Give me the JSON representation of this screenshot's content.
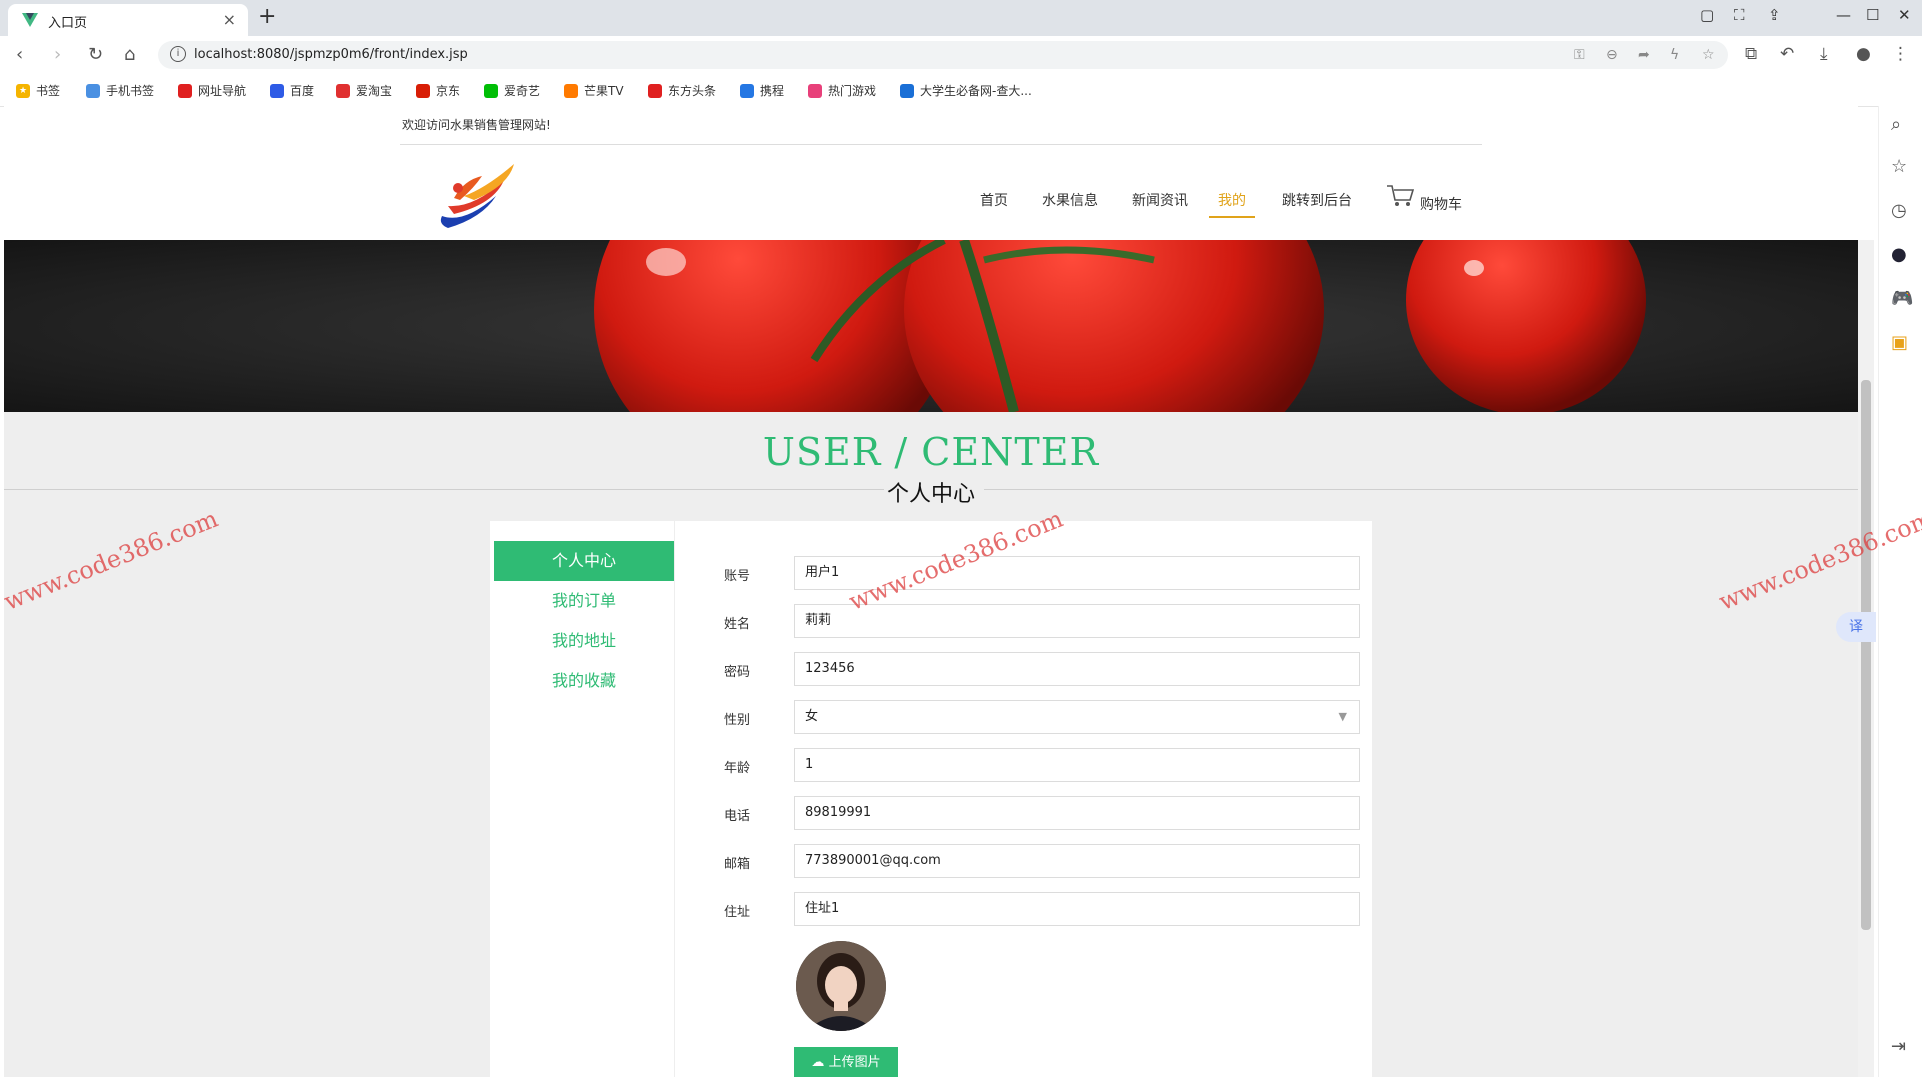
{
  "browser": {
    "tab_title": "入口页",
    "url": "localhost:8080/jspmzp0m6/front/index.jsp",
    "bookmarks": [
      {
        "label": "书签",
        "color": "#f5b400"
      },
      {
        "label": "手机书签",
        "color": "#4a90e2"
      },
      {
        "label": "网址导航",
        "color": "#e02020"
      },
      {
        "label": "百度",
        "color": "#2e5be6"
      },
      {
        "label": "爱淘宝",
        "color": "#e03030"
      },
      {
        "label": "京东",
        "color": "#d81e06"
      },
      {
        "label": "爱奇艺",
        "color": "#00be06"
      },
      {
        "label": "芒果TV",
        "color": "#ff7a00"
      },
      {
        "label": "东方头条",
        "color": "#e02020"
      },
      {
        "label": "携程",
        "color": "#2577e3"
      },
      {
        "label": "热门游戏",
        "color": "#e8407a"
      },
      {
        "label": "大学生必备网-查大...",
        "color": "#1a6fd6"
      }
    ],
    "translate_label": "译"
  },
  "header": {
    "welcome": "欢迎访问水果销售管理网站!",
    "nav": [
      "首页",
      "水果信息",
      "新闻资讯",
      "我的",
      "跳转到后台"
    ],
    "active_nav": "我的",
    "cart_label": "购物车"
  },
  "section": {
    "title_en": "USER / CENTER",
    "title_cn": "个人中心"
  },
  "sidebar": {
    "items": [
      "个人中心",
      "我的订单",
      "我的地址",
      "我的收藏"
    ],
    "active": "个人中心"
  },
  "form": {
    "fields": [
      {
        "label": "账号",
        "value": "用户1",
        "type": "text"
      },
      {
        "label": "姓名",
        "value": "莉莉",
        "type": "text"
      },
      {
        "label": "密码",
        "value": "123456",
        "type": "text"
      },
      {
        "label": "性别",
        "value": "女",
        "type": "select"
      },
      {
        "label": "年龄",
        "value": "1",
        "type": "text"
      },
      {
        "label": "电话",
        "value": "89819991",
        "type": "text"
      },
      {
        "label": "邮箱",
        "value": "773890001@qq.com",
        "type": "text"
      },
      {
        "label": "住址",
        "value": "住址1",
        "type": "text"
      }
    ],
    "upload_label": "上传图片"
  },
  "watermark": "www.code386.com",
  "colors": {
    "accent": "#2fbb74",
    "nav_active": "#e0a31a"
  }
}
